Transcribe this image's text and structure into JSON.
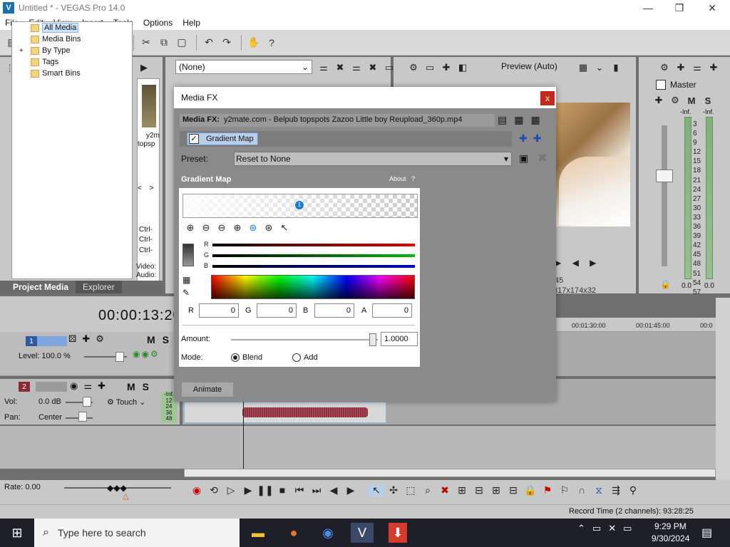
{
  "window": {
    "title": "Untitled * - VEGAS Pro 14.0"
  },
  "menu": [
    "File",
    "Edit",
    "View",
    "Insert",
    "Tools",
    "Options",
    "Help"
  ],
  "project_media": {
    "tree": [
      "All Media",
      "Media Bins",
      "By Type",
      "Tags",
      "Smart Bins"
    ],
    "thumb_caption1": "y2m",
    "thumb_caption2": "topsp",
    "ctrl_labels": [
      "Ctrl-",
      "Ctrl-",
      "Ctrl-"
    ],
    "video_label": "Video:",
    "audio_label": "Audio:",
    "tabs": [
      "Project Media",
      "Explorer"
    ]
  },
  "fx_panel": {
    "dropdown": "(None)"
  },
  "preview": {
    "mode": "Preview (Auto)",
    "info1": "45",
    "info2": "317x174x32"
  },
  "master": {
    "label": "Master",
    "inf_left": "-Inf.",
    "inf_right": "-Inf.",
    "scale": [
      "3",
      "6",
      "9",
      "12",
      "15",
      "18",
      "21",
      "24",
      "27",
      "30",
      "33",
      "36",
      "39",
      "42",
      "45",
      "48",
      "51",
      "54",
      "57"
    ],
    "val_left": "0.0",
    "val_right": "0.0"
  },
  "timeline": {
    "timecode": "00:00:13:20",
    "ruler_marks": [
      "00:01:30:00",
      "00:01:45:00",
      "00:0"
    ]
  },
  "track1": {
    "number": "1",
    "level": "Level: 100.0 %"
  },
  "track2": {
    "number": "2",
    "vol": "Vol:",
    "vol_value": "0.0 dB",
    "pan": "Pan:",
    "pan_value": "Center",
    "mode": "Touch",
    "meter_labels": [
      "-Inf.",
      "12",
      "24",
      "36",
      "48"
    ]
  },
  "transport": {
    "rate": "Rate: 0.00"
  },
  "status": {
    "record_time": "Record Time (2 channels): 93:28:25"
  },
  "dialog": {
    "title": "Media FX",
    "close": "x",
    "source_label": "Media FX:",
    "source_file": "y2mate.com - Belpub topspots Zazoo Little boy Reupload_360p.mp4",
    "chain_fx": "Gradient Map",
    "preset_label": "Preset:",
    "preset_value": "Reset to None",
    "plugin_name": "Gradient Map",
    "about": "About",
    "help": "?",
    "stop_number": "1",
    "channel_r": "R",
    "channel_g": "G",
    "channel_b": "B",
    "rgba_labels": [
      "R",
      "G",
      "B",
      "A"
    ],
    "rgba_values": [
      "0",
      "0",
      "0",
      "0"
    ],
    "amount_label": "Amount:",
    "amount_value": "1.0000",
    "mode_label": "Mode:",
    "mode_blend": "Blend",
    "mode_add": "Add",
    "animate": "Animate"
  },
  "taskbar": {
    "search_placeholder": "Type here to search",
    "time": "9:29 PM",
    "date": "9/30/2024"
  }
}
